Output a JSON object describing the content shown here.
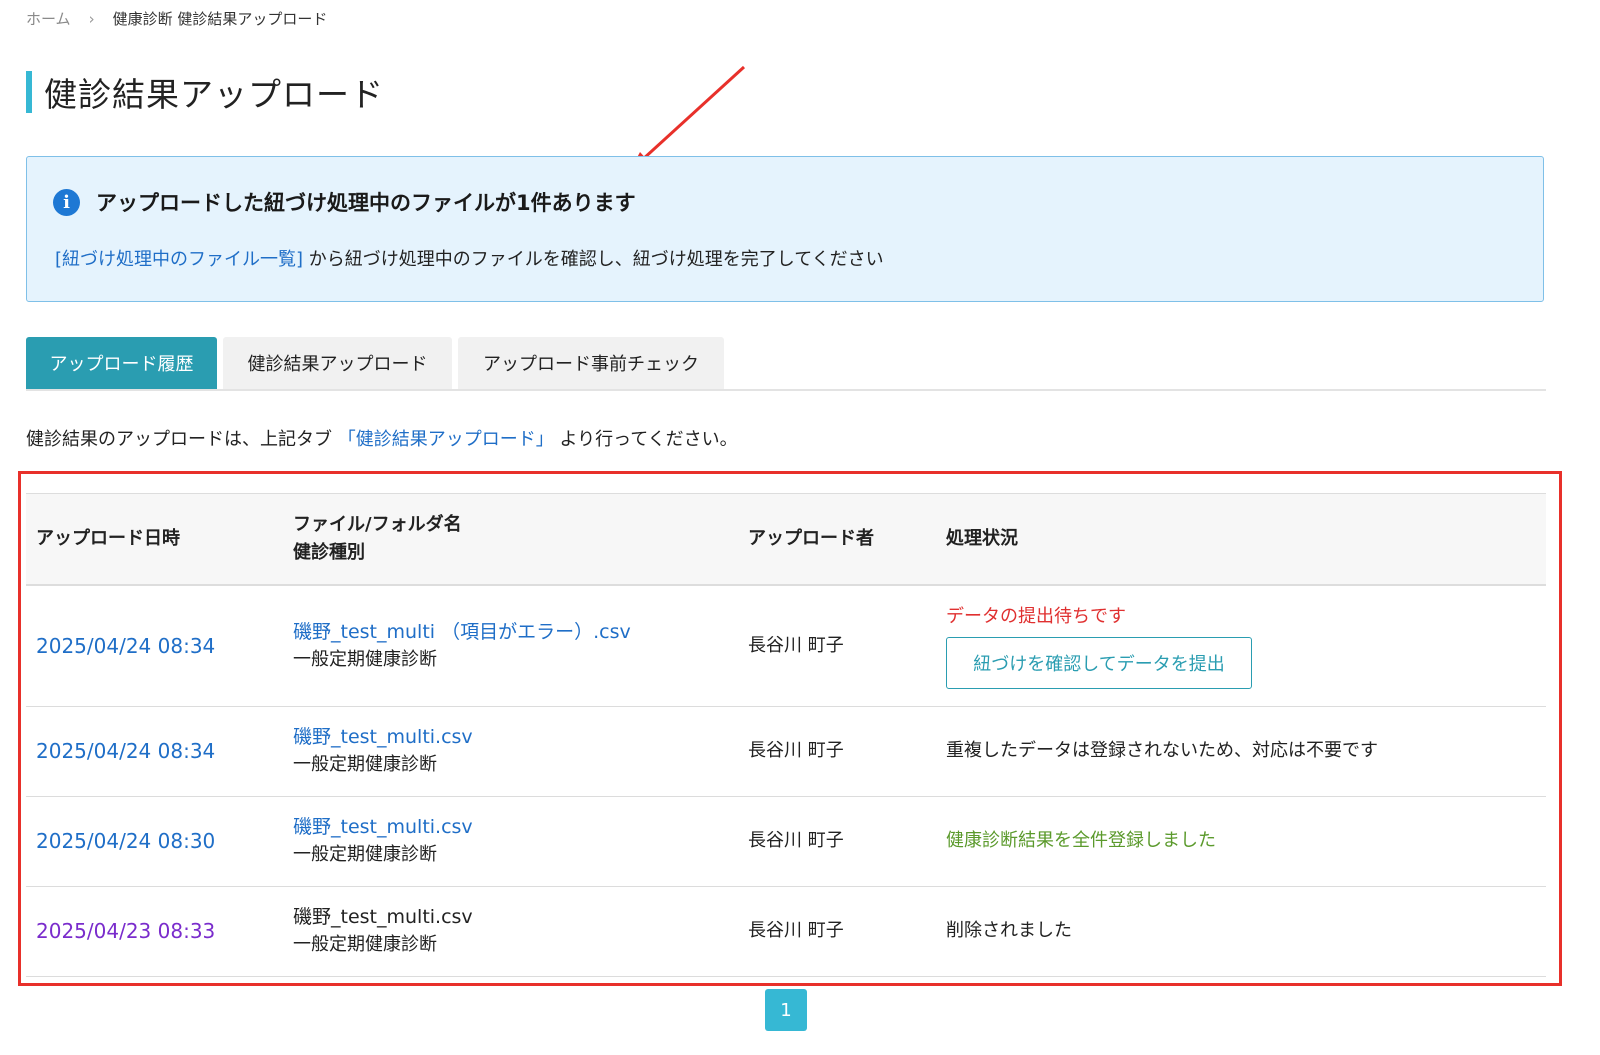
{
  "breadcrumb": {
    "home": "ホーム",
    "separator": "›",
    "current": "健康診断 健診結果アップロード"
  },
  "page": {
    "title": "健診結果アップロード"
  },
  "info": {
    "icon": "info-icon",
    "icon_glyph": "i",
    "title": "アップロードした紐づけ処理中のファイルが1件あります",
    "link_text": "[紐づけ処理中のファイル一覧]",
    "body_text": " から紐づけ処理中のファイルを確認し、紐づけ処理を完了してください"
  },
  "tabs": [
    {
      "label": "アップロード履歴",
      "active": true
    },
    {
      "label": "健診結果アップロード",
      "active": false
    },
    {
      "label": "アップロード事前チェック",
      "active": false
    }
  ],
  "instruction": {
    "prefix": "健診結果のアップロードは、上記タブ",
    "link": "「健診結果アップロード」",
    "suffix": " より行ってください。"
  },
  "table": {
    "headers": {
      "date": "アップロード日時",
      "file_line1": "ファイル/フォルダ名",
      "file_line2": "健診種別",
      "uploader": "アップロード者",
      "status": "処理状況"
    },
    "rows": [
      {
        "date": "2025/04/24 08:34",
        "file": "磯野_test_multi （項目がエラー）.csv",
        "type": "一般定期健康診断",
        "uploader": "長谷川 町子",
        "status": "データの提出待ちです",
        "button": "紐づけを確認してデータを提出"
      },
      {
        "date": "2025/04/24 08:34",
        "file": "磯野_test_multi.csv",
        "type": "一般定期健康診断",
        "uploader": "長谷川 町子",
        "status": "重複したデータは登録されないため、対応は不要です"
      },
      {
        "date": "2025/04/24 08:30",
        "file": "磯野_test_multi.csv",
        "type": "一般定期健康診断",
        "uploader": "長谷川 町子",
        "status": "健康診断結果を全件登録しました"
      },
      {
        "date": "2025/04/23 08:33",
        "file": "磯野_test_multi.csv",
        "type": "一般定期健康診断",
        "uploader": "長谷川 町子",
        "status": "削除されました"
      }
    ]
  },
  "pagination": {
    "current": "1"
  },
  "colors": {
    "accent": "#2a9db1",
    "title_bar": "#36b8d4",
    "link": "#1f6ec7",
    "visited_link": "#7a2ccc",
    "error": "#e03030",
    "success": "#5b9a2c",
    "annotation": "#e8302a",
    "info_bg": "#e5f3fd"
  }
}
